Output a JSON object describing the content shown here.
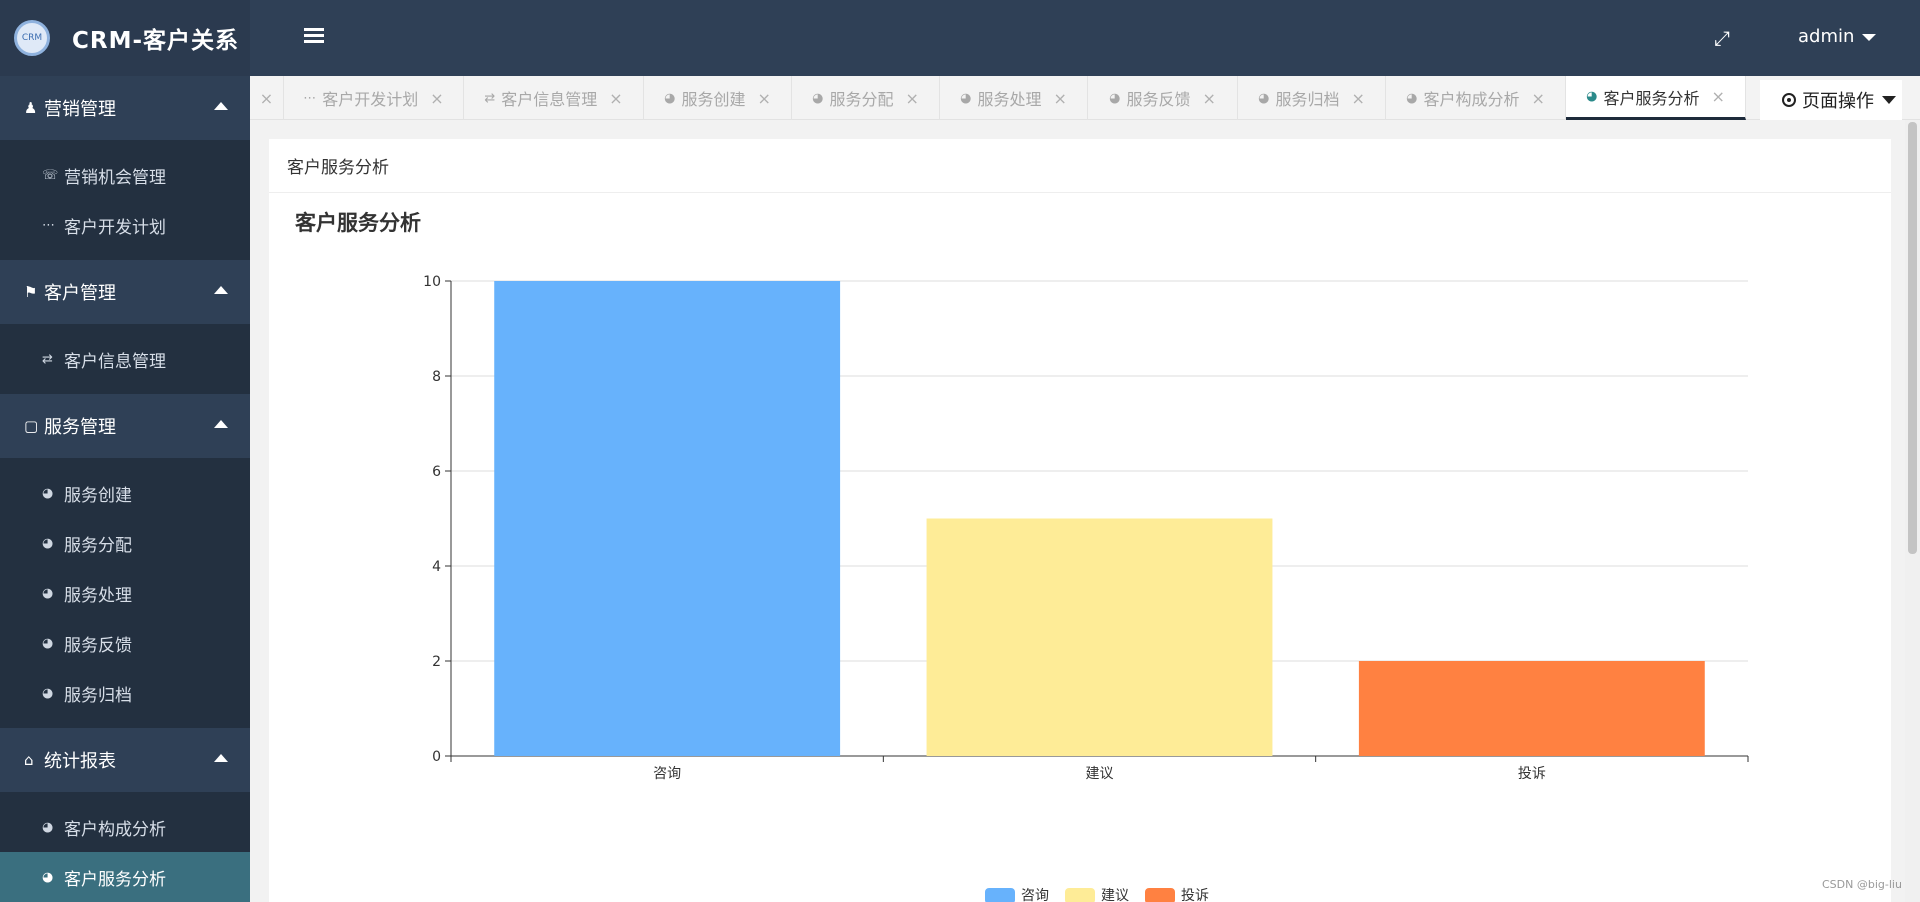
{
  "app": {
    "title": "CRM-客户关系",
    "logo_text": "CRM"
  },
  "sidebar": {
    "groups": [
      {
        "label": "营销管理",
        "icon": "user-icon",
        "items": [
          {
            "label": "营销机会管理",
            "icon": "phone-icon"
          },
          {
            "label": "客户开发计划",
            "icon": "ellipsis-icon"
          }
        ]
      },
      {
        "label": "客户管理",
        "icon": "flag-icon",
        "items": [
          {
            "label": "客户信息管理",
            "icon": "exchange-icon"
          }
        ]
      },
      {
        "label": "服务管理",
        "icon": "monitor-icon",
        "items": [
          {
            "label": "服务创建",
            "icon": "dashboard-icon"
          },
          {
            "label": "服务分配",
            "icon": "dashboard-icon"
          },
          {
            "label": "服务处理",
            "icon": "dashboard-icon"
          },
          {
            "label": "服务反馈",
            "icon": "dashboard-icon"
          },
          {
            "label": "服务归档",
            "icon": "dashboard-icon"
          }
        ]
      },
      {
        "label": "统计报表",
        "icon": "home-icon",
        "items": [
          {
            "label": "客户构成分析",
            "icon": "dashboard-icon"
          },
          {
            "label": "客户服务分析",
            "icon": "dashboard-icon",
            "active": true
          }
        ]
      }
    ]
  },
  "header": {
    "user": "admin"
  },
  "tabs": [
    {
      "label": "客户开发计划",
      "icon": "ellipsis-icon"
    },
    {
      "label": "客户信息管理",
      "icon": "exchange-icon"
    },
    {
      "label": "服务创建",
      "icon": "dashboard-icon"
    },
    {
      "label": "服务分配",
      "icon": "dashboard-icon"
    },
    {
      "label": "服务处理",
      "icon": "dashboard-icon"
    },
    {
      "label": "服务反馈",
      "icon": "dashboard-icon"
    },
    {
      "label": "服务归档",
      "icon": "dashboard-icon"
    },
    {
      "label": "客户构成分析",
      "icon": "dashboard-icon"
    },
    {
      "label": "客户服务分析",
      "icon": "dashboard-icon",
      "active": true
    }
  ],
  "page_ops_label": "页面操作",
  "card": {
    "header": "客户服务分析"
  },
  "chart_data": {
    "type": "bar",
    "title": "客户服务分析",
    "categories": [
      "咨询",
      "建议",
      "投诉"
    ],
    "values": [
      10,
      5,
      2
    ],
    "colors": [
      "#67b2fc",
      "#feec97",
      "#ff8141"
    ],
    "ylim": [
      0,
      10
    ],
    "yticks": [
      0,
      2,
      4,
      6,
      8,
      10
    ],
    "grid": true,
    "legend": "bottom-center",
    "legend_entries": [
      "咨询",
      "建议",
      "投诉"
    ]
  },
  "watermark": "CSDN @big-liu"
}
